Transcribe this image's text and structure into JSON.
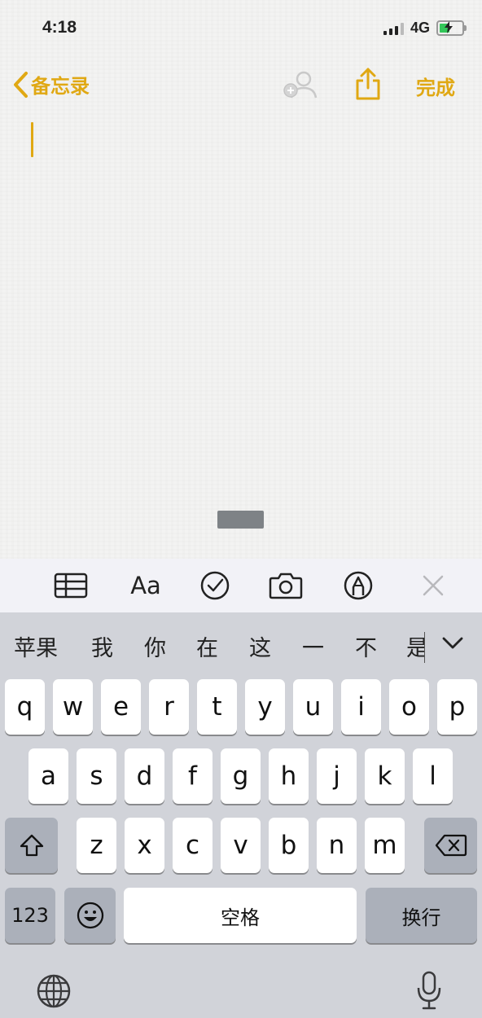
{
  "status_bar": {
    "time": "4:18",
    "network": "4G"
  },
  "nav": {
    "back_label": "备忘录",
    "done_label": "完成"
  },
  "candidates": [
    "苹果",
    "我",
    "你",
    "在",
    "这",
    "一",
    "不",
    "是"
  ],
  "keyboard": {
    "row1": [
      "q",
      "w",
      "e",
      "r",
      "t",
      "y",
      "u",
      "i",
      "o",
      "p"
    ],
    "row2": [
      "a",
      "s",
      "d",
      "f",
      "g",
      "h",
      "j",
      "k",
      "l"
    ],
    "row3": [
      "z",
      "x",
      "c",
      "v",
      "b",
      "n",
      "m"
    ],
    "numbers_label": "123",
    "space_label": "空格",
    "return_label": "换行"
  },
  "toolbar": {
    "format_label": "Aa"
  },
  "colors": {
    "accent": "#e0a813",
    "battery": "#33c759",
    "keyboard_bg": "#d1d3d9"
  },
  "icons": [
    "chevron-left-icon",
    "add-people-icon",
    "share-icon",
    "table-icon",
    "checklist-icon",
    "camera-icon",
    "markup-icon",
    "close-icon",
    "shift-icon",
    "delete-icon",
    "emoji-icon",
    "globe-icon",
    "microphone-icon",
    "chevron-down-icon"
  ]
}
